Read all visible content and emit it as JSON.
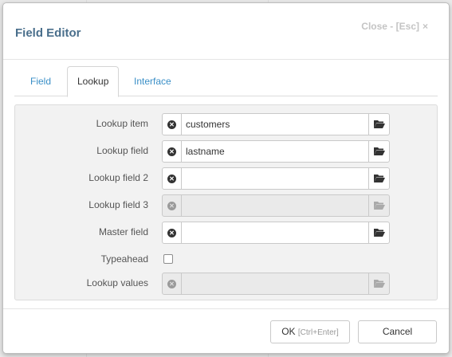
{
  "dialog": {
    "title": "Field Editor",
    "close_label": "Close - [Esc]",
    "close_symbol": "×"
  },
  "tabs": [
    {
      "label": "Field",
      "active": false
    },
    {
      "label": "Lookup",
      "active": true
    },
    {
      "label": "Interface",
      "active": false
    }
  ],
  "form": {
    "lookup_item": {
      "label": "Lookup item",
      "value": "customers",
      "enabled": true
    },
    "lookup_field": {
      "label": "Lookup field",
      "value": "lastname",
      "enabled": true
    },
    "lookup_field_2": {
      "label": "Lookup field 2",
      "value": "",
      "enabled": true
    },
    "lookup_field_3": {
      "label": "Lookup field 3",
      "value": "",
      "enabled": false
    },
    "master_field": {
      "label": "Master field",
      "value": "",
      "enabled": true
    },
    "typeahead": {
      "label": "Typeahead",
      "checked": false
    },
    "lookup_values": {
      "label": "Lookup values",
      "value": "",
      "enabled": false
    }
  },
  "footer": {
    "ok_label": "OK",
    "ok_shortcut": "[Ctrl+Enter]",
    "cancel_label": "Cancel"
  },
  "icons": {
    "clear": "times-circle-icon",
    "browse": "folder-open-icon"
  },
  "colors": {
    "title": "#4a6f8c",
    "link": "#3a8fc7",
    "panel_bg": "#f2f2f2"
  }
}
